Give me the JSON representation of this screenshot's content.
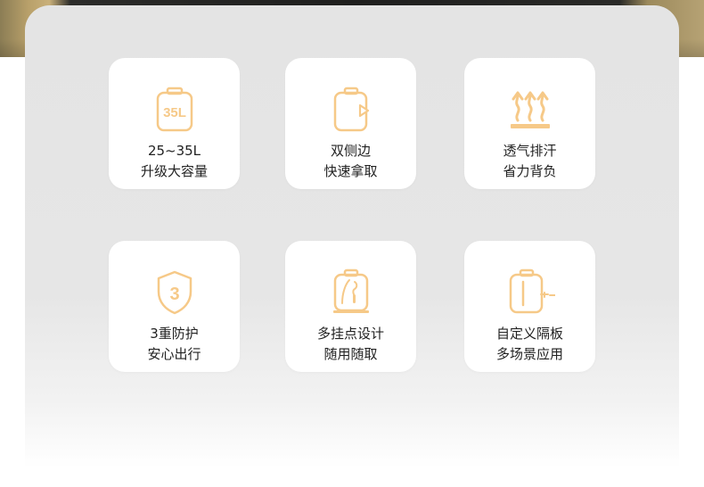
{
  "accent_color": "#f6c988",
  "features": [
    {
      "icon": "backpack-35l-icon",
      "badge": "35L",
      "line1": "25~35L",
      "line2": "升级大容量"
    },
    {
      "icon": "side-pocket-icon",
      "line1": "双侧边",
      "line2": "快速拿取"
    },
    {
      "icon": "heat-vent-icon",
      "line1": "透气排汗",
      "line2": "省力背负"
    },
    {
      "icon": "shield-3-icon",
      "badge": "3",
      "line1": "3重防护",
      "line2": "安心出行"
    },
    {
      "icon": "hanging-points-icon",
      "line1": "多挂点设计",
      "line2": "随用随取"
    },
    {
      "icon": "divider-icon",
      "line1": "自定义隔板",
      "line2": "多场景应用"
    }
  ]
}
